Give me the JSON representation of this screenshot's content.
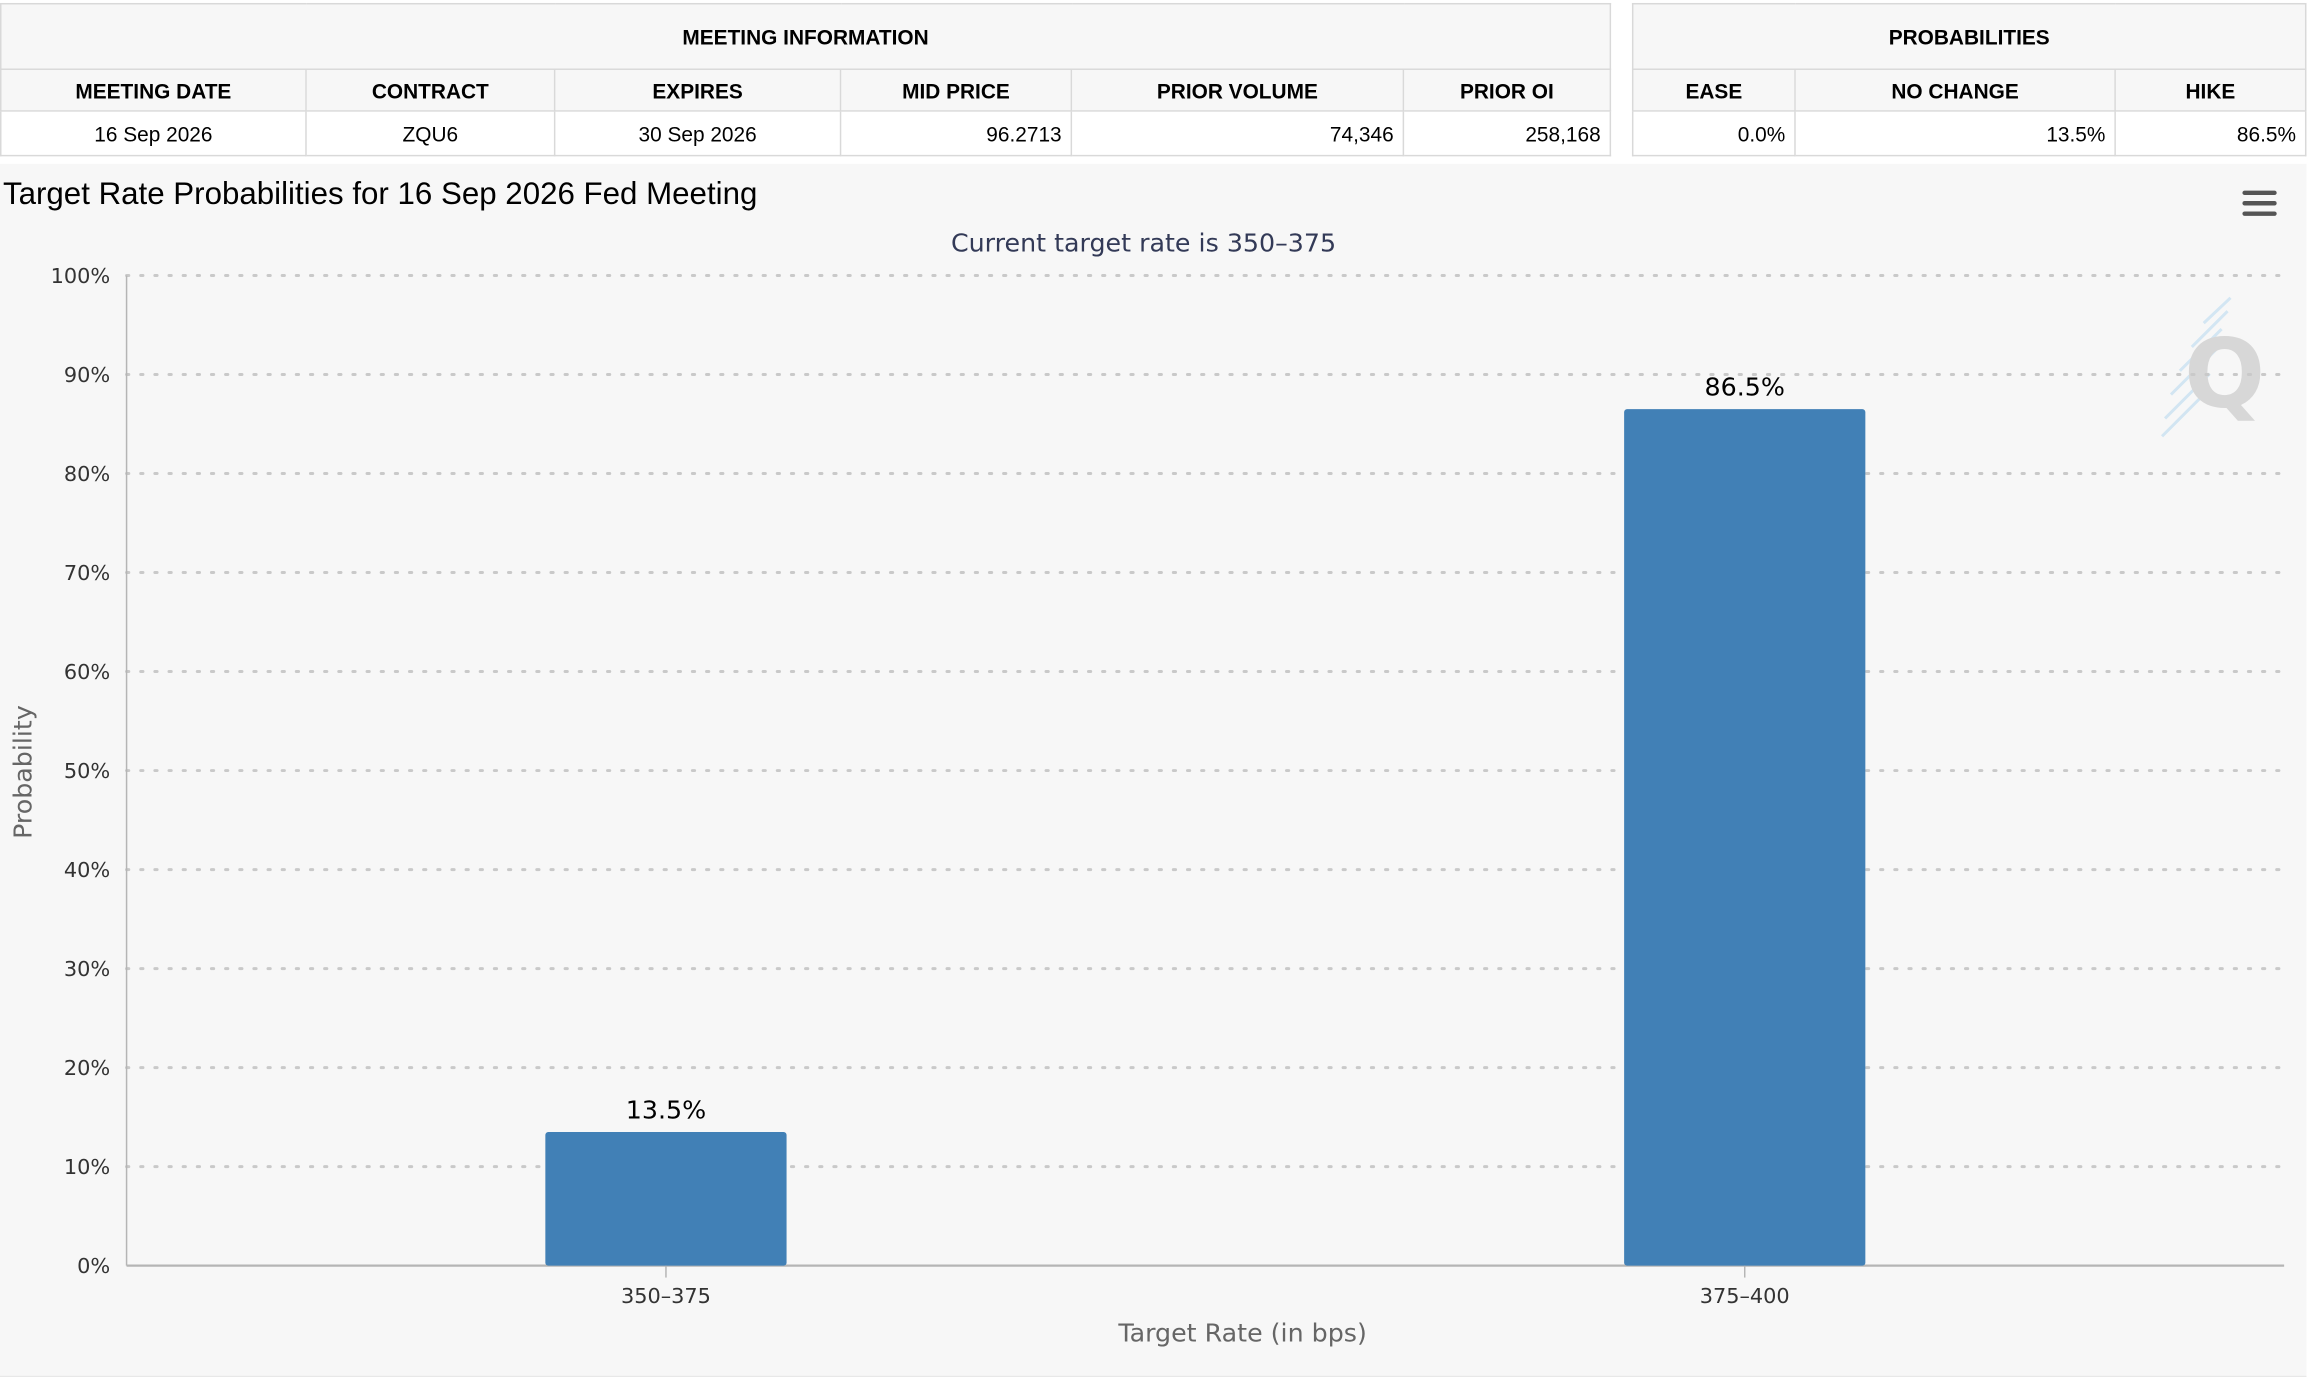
{
  "meeting_table": {
    "group_header": "MEETING INFORMATION",
    "columns": [
      "MEETING DATE",
      "CONTRACT",
      "EXPIRES",
      "MID PRICE",
      "PRIOR VOLUME",
      "PRIOR OI"
    ],
    "row": [
      "16 Sep 2026",
      "ZQU6",
      "30 Sep 2026",
      "96.2713",
      "74,346",
      "258,168"
    ]
  },
  "probabilities_table": {
    "group_header": "PROBABILITIES",
    "columns": [
      "EASE",
      "NO CHANGE",
      "HIKE"
    ],
    "row": [
      "0.0%",
      "13.5%",
      "86.5%"
    ]
  },
  "chart_menu": {
    "icon": "hamburger-menu-icon"
  },
  "watermark": {
    "icon": "q-logo-watermark-icon",
    "glyph": "Q"
  },
  "colors": {
    "bar": "#4180b6",
    "grid": "#c9c9c9",
    "subtitle": "#333a57",
    "axis_text": "#333333"
  },
  "chart_data": {
    "type": "bar",
    "title": "Target Rate Probabilities for 16 Sep 2026 Fed Meeting",
    "subtitle": "Current target rate is 350–375",
    "xlabel": "Target Rate (in bps)",
    "ylabel": "Probability",
    "categories": [
      "350–375",
      "375–400"
    ],
    "values": [
      13.5,
      86.5
    ],
    "data_labels": [
      "13.5%",
      "86.5%"
    ],
    "ylim": [
      0,
      100
    ],
    "yticks": [
      "0%",
      "10%",
      "20%",
      "30%",
      "40%",
      "50%",
      "60%",
      "70%",
      "80%",
      "90%",
      "100%"
    ],
    "grid": true,
    "legend": "none"
  }
}
